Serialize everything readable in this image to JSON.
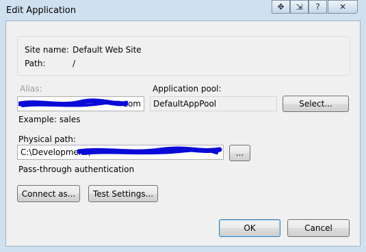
{
  "window": {
    "title": "Edit Application",
    "controls": {
      "move": "✥",
      "switch": "⇲",
      "help": "?",
      "close": "✕"
    }
  },
  "site_info": {
    "site_name_label": "Site name:",
    "site_name_value": "Default Web Site",
    "path_label": "Path:",
    "path_value": "/"
  },
  "alias": {
    "label": "Alias:",
    "value": "com",
    "example": "Example: sales"
  },
  "app_pool": {
    "label": "Application pool:",
    "value": "DefaultAppPool",
    "select_button": "Select..."
  },
  "physical_path": {
    "label": "Physical path:",
    "value": "C:\\Development\\",
    "browse_button": "..."
  },
  "auth": {
    "label": "Pass-through authentication"
  },
  "buttons": {
    "connect_as": "Connect as...",
    "test_settings": "Test Settings...",
    "ok": "OK",
    "cancel": "Cancel"
  }
}
